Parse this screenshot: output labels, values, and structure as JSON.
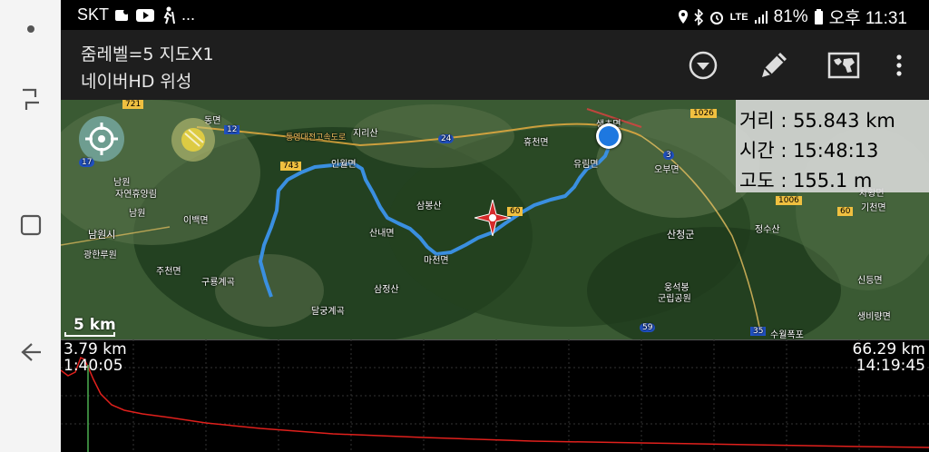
{
  "status_bar": {
    "carrier": "SKT",
    "more": "...",
    "network": "LTE",
    "battery": "81%",
    "time": "오후 11:31"
  },
  "action_bar": {
    "title_line1": "줌레벨=5 지도X1",
    "title_line2": "네이버HD 위성"
  },
  "stats": {
    "distance": "거리 : 55.843 km",
    "time": "시간 : 15:48:13",
    "altitude": "고도 : 155.1 m"
  },
  "scale": {
    "label": "5 km"
  },
  "map_labels": [
    {
      "text": "남원"
    },
    {
      "text": "자연휴양림"
    },
    {
      "text": "남원"
    },
    {
      "text": "남원시"
    },
    {
      "text": "광한루원"
    },
    {
      "text": "이백면"
    },
    {
      "text": "지리산"
    },
    {
      "text": "인월면"
    },
    {
      "text": "산내면"
    },
    {
      "text": "삼봉산"
    },
    {
      "text": "구룡계곡"
    },
    {
      "text": "달궁계곡"
    },
    {
      "text": "삼정산"
    },
    {
      "text": "마천면"
    },
    {
      "text": "휴천면"
    },
    {
      "text": "유림면"
    },
    {
      "text": "생초면"
    },
    {
      "text": "오부면"
    },
    {
      "text": "산청군"
    },
    {
      "text": "웅석봉"
    },
    {
      "text": "군립공원"
    },
    {
      "text": "수월폭포"
    },
    {
      "text": "정수산"
    },
    {
      "text": "신등면"
    },
    {
      "text": "생비량면"
    },
    {
      "text": "차황면"
    },
    {
      "text": "기천면"
    },
    {
      "text": "통영대전고속도로"
    },
    {
      "text": "주천면"
    },
    {
      "text": "동면"
    }
  ],
  "road_numbers": [
    "721",
    "12",
    "17",
    "743",
    "24",
    "60",
    "3",
    "1026",
    "1006",
    "60",
    "59",
    "35"
  ],
  "chart": {
    "start_distance": "3.79 km",
    "start_time": "1:40:05",
    "end_distance": "66.29 km",
    "end_time": "14:19:45",
    "line_color": "#e0201c",
    "cursor_color": "#4caf50"
  },
  "colors": {
    "track": "#3a8fe0",
    "actionbar_bg": "#1e1e1e",
    "navbar_bg": "#f4f4f4"
  }
}
